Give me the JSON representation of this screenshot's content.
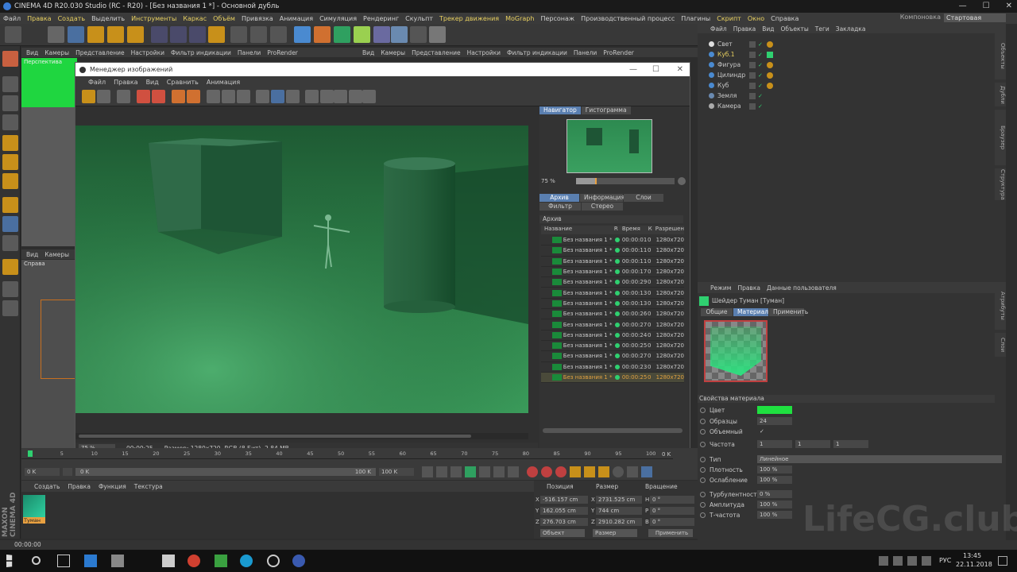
{
  "window_title": "CINEMA 4D R20.030 Studio (RC - R20) - [Без названия 1 *] - Основной дубль",
  "menu": [
    "Файл",
    "Правка",
    "Создать",
    "Выделить",
    "Инструменты",
    "Каркас",
    "Объём",
    "Привязка",
    "Анимация",
    "Симуляция",
    "Рендеринг",
    "Скульпт",
    "Трекер движения",
    "MoGraph",
    "Персонаж",
    "Производственный процесс",
    "Плагины",
    "Скрипт",
    "Окно",
    "Справка"
  ],
  "layout_label": "Компоновка",
  "layout_value": "Стартовая",
  "viewport_menu": [
    "Вид",
    "Камеры",
    "Представление",
    "Настройки",
    "Фильтр индикации",
    "Панели",
    "ProRender"
  ],
  "viewport_label": "Перспектива",
  "viewport2_menu": [
    "Вид",
    "Камеры"
  ],
  "viewport2_label": "Справа",
  "image_manager": {
    "title": "Менеджер изображений",
    "menu": [
      "Файл",
      "Правка",
      "Вид",
      "Сравнить",
      "Анимация"
    ],
    "nav_tabs": [
      "Навигатор",
      "Гистограмма"
    ],
    "zoom": "75 %",
    "tabs_row1": [
      "Архив",
      "Информация",
      "Слои"
    ],
    "tabs_row2": [
      "Фильтр",
      "Стерео"
    ],
    "archive_label": "Архив",
    "columns": [
      "Название",
      "R",
      "Время",
      "К",
      "Разрешен"
    ],
    "rows": [
      {
        "name": "Без названия 1 *",
        "time": "00:00:01",
        "k": "0",
        "res": "1280x720"
      },
      {
        "name": "Без названия 1 *",
        "time": "00:00:11",
        "k": "0",
        "res": "1280x720"
      },
      {
        "name": "Без названия 1 *",
        "time": "00:00:11",
        "k": "0",
        "res": "1280x720"
      },
      {
        "name": "Без названия 1 *",
        "time": "00:00:17",
        "k": "0",
        "res": "1280x720"
      },
      {
        "name": "Без названия 1 *",
        "time": "00:00:29",
        "k": "0",
        "res": "1280x720"
      },
      {
        "name": "Без названия 1 *",
        "time": "00:00:13",
        "k": "0",
        "res": "1280x720"
      },
      {
        "name": "Без названия 1 *",
        "time": "00:00:13",
        "k": "0",
        "res": "1280x720"
      },
      {
        "name": "Без названия 1 *",
        "time": "00:00:26",
        "k": "0",
        "res": "1280x720"
      },
      {
        "name": "Без названия 1 *",
        "time": "00:00:27",
        "k": "0",
        "res": "1280x720"
      },
      {
        "name": "Без названия 1 *",
        "time": "00:00:24",
        "k": "0",
        "res": "1280x720"
      },
      {
        "name": "Без названия 1 *",
        "time": "00:00:25",
        "k": "0",
        "res": "1280x720"
      },
      {
        "name": "Без названия 1 *",
        "time": "00:00:27",
        "k": "0",
        "res": "1280x720"
      },
      {
        "name": "Без названия 1 *",
        "time": "00:00:23",
        "k": "0",
        "res": "1280x720"
      },
      {
        "name": "Без названия 1 *",
        "time": "00:00:25",
        "k": "0",
        "res": "1280x720"
      }
    ],
    "status_zoom": "75 %",
    "status_time": "00:00:25",
    "status_info": "Размер: 1280x720, RGB (8 Бит), 2.84 MB"
  },
  "object_manager": {
    "menu": [
      "Файл",
      "Правка",
      "Вид",
      "Объекты",
      "Теги",
      "Закладка"
    ],
    "objects": [
      "Свет",
      "Куб.1",
      "Фигура",
      "Цилиндр",
      "Куб",
      "Земля",
      "Камера"
    ]
  },
  "attr_manager": {
    "menu": [
      "Режим",
      "Правка",
      "Данные пользователя"
    ],
    "title": "Шейдер Туман [Туман]",
    "tabs": [
      "Общие",
      "Материал",
      "Применить"
    ],
    "section": "Свойства материала",
    "props": [
      {
        "label": "Цвет",
        "value": ""
      },
      {
        "label": "Образцы",
        "value": "24"
      },
      {
        "label": "Объемный",
        "value": "✓"
      },
      {
        "label": "Частота",
        "value": "1"
      },
      {
        "label": "Тип",
        "value": "Линейное"
      },
      {
        "label": "Плотность",
        "value": "100 %"
      },
      {
        "label": "Ослабление",
        "value": "100 %"
      },
      {
        "label": "Турбулентность",
        "value": "0 %"
      },
      {
        "label": "Амплитуда",
        "value": "100 %"
      },
      {
        "label": "Т-частота",
        "value": "100 %"
      }
    ],
    "freq2": "1",
    "freq3": "1"
  },
  "timeline": {
    "ticks": [
      "0",
      "5",
      "10",
      "15",
      "20",
      "25",
      "30",
      "35",
      "40",
      "45",
      "50",
      "55",
      "60",
      "65",
      "70",
      "75",
      "80",
      "85",
      "90",
      "95",
      "100"
    ],
    "start": "0 K",
    "field2": "0 K",
    "end": "100 K",
    "end2": "100 K",
    "right": "0 K"
  },
  "material_panel": {
    "menu": [
      "Создать",
      "Правка",
      "Функция",
      "Текстура"
    ],
    "material_name": "Туман"
  },
  "coords": {
    "headers": [
      "Позиция",
      "Размер",
      "Вращение"
    ],
    "x": "-516.157 cm",
    "y": "162.055 cm",
    "z": "276.703 cm",
    "sx": "2731.525 cm",
    "sy": "744 cm",
    "sz": "2910.282 cm",
    "h": "0 °",
    "p": "0 °",
    "b": "0 °",
    "mode": "Объект",
    "size_mode": "Размер",
    "apply": "Применить"
  },
  "status_time": "00:00:00",
  "taskbar": {
    "lang": "РУС",
    "time": "13:45",
    "date": "22.11.2018"
  },
  "watermark": "LifeCG.club",
  "brand": "MAXON CINEMA 4D",
  "colors": {
    "accent": "#5a7fb0",
    "green": "#1fd640",
    "highlight": "#e8d060"
  }
}
